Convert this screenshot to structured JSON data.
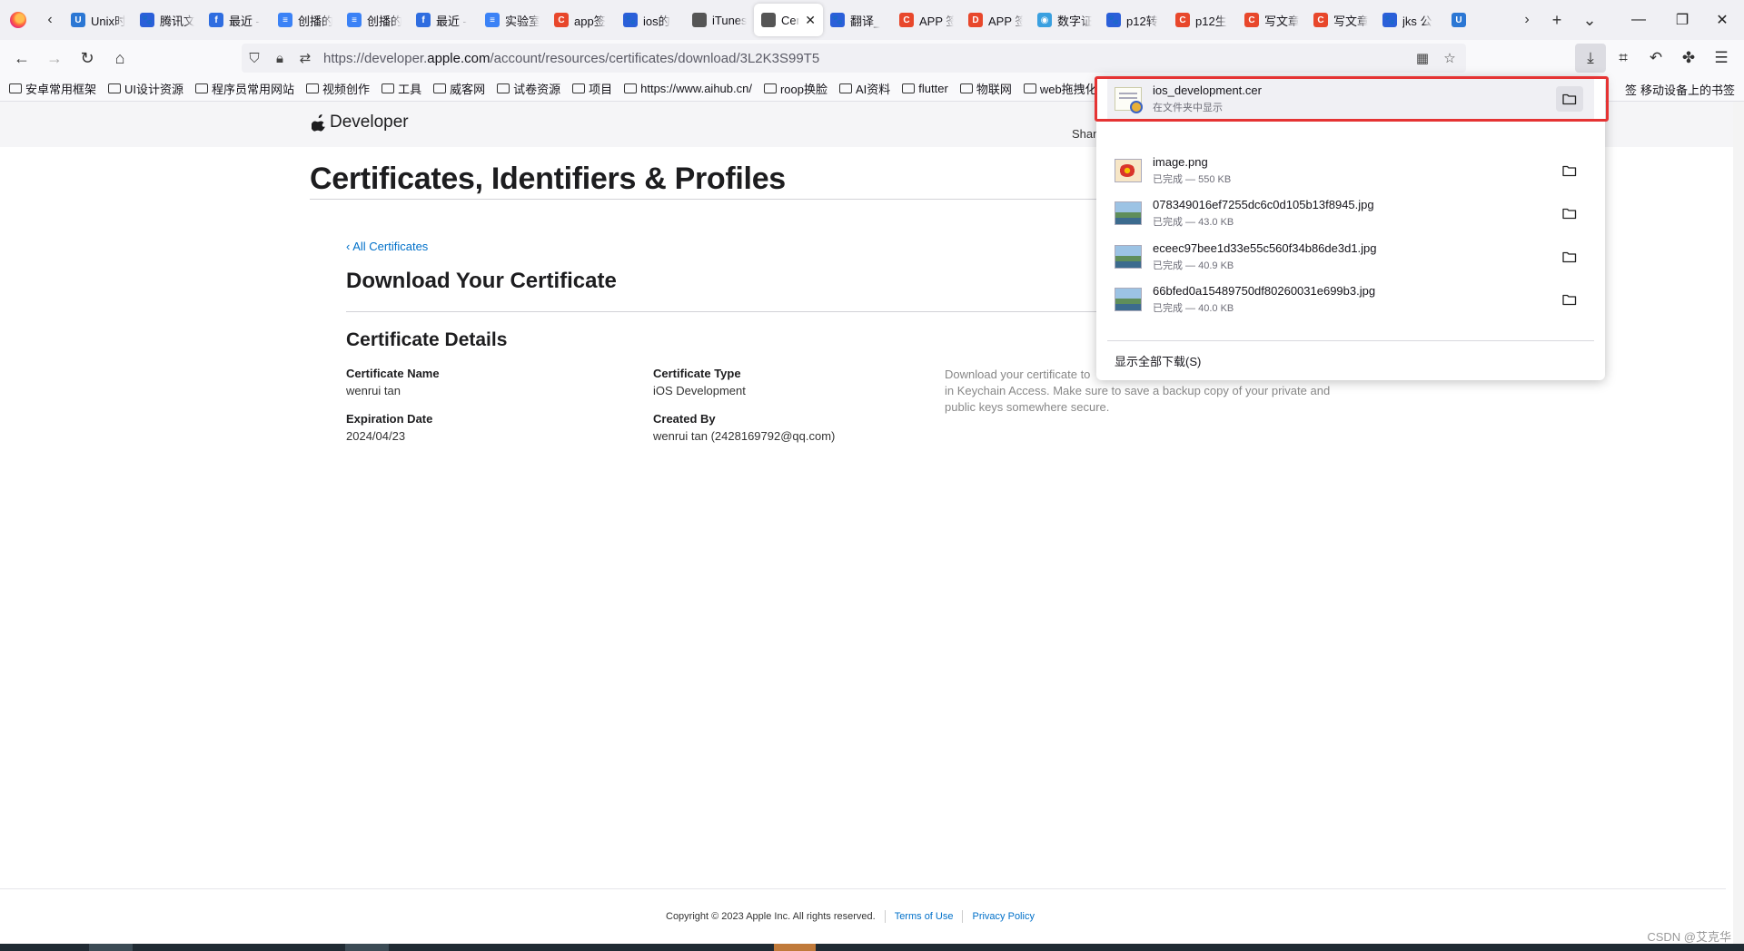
{
  "browser": {
    "tabs": [
      {
        "label": "Unix时",
        "icon_color": "#2b77d4",
        "icon": "U"
      },
      {
        "label": "腾讯文",
        "icon_color": "#2b5fd9",
        "icon": "🐾"
      },
      {
        "label": "最近 -",
        "icon_color": "#2f6de0",
        "icon": "f"
      },
      {
        "label": "创播的",
        "icon_color": "#3b82f6",
        "icon": "≡"
      },
      {
        "label": "创播的",
        "icon_color": "#3b82f6",
        "icon": "≡"
      },
      {
        "label": "最近 -",
        "icon_color": "#2f6de0",
        "icon": "f"
      },
      {
        "label": "实验室",
        "icon_color": "#3b82f6",
        "icon": "≡"
      },
      {
        "label": "app签",
        "icon_color": "#e8472b",
        "icon": "C"
      },
      {
        "label": "ios的",
        "icon_color": "#2b5fd9",
        "icon": "🐾"
      },
      {
        "label": "iTunes",
        "icon_color": "#555555",
        "icon": ""
      },
      {
        "label": "Cer",
        "icon_color": "#555555",
        "icon": "",
        "active": true
      },
      {
        "label": "翻译_",
        "icon_color": "#2b5fd9",
        "icon": "🐾"
      },
      {
        "label": "APP 签",
        "icon_color": "#e8472b",
        "icon": "C"
      },
      {
        "label": "APP 签",
        "icon_color": "#e8472b",
        "icon": "D"
      },
      {
        "label": "数字证",
        "icon_color": "#3aa0e0",
        "icon": "◉"
      },
      {
        "label": "p12转",
        "icon_color": "#2b5fd9",
        "icon": "🐾"
      },
      {
        "label": "p12生",
        "icon_color": "#e8472b",
        "icon": "C"
      },
      {
        "label": "写文章",
        "icon_color": "#e8472b",
        "icon": "C"
      },
      {
        "label": "写文章",
        "icon_color": "#e8472b",
        "icon": "C"
      },
      {
        "label": "jks 公",
        "icon_color": "#2b5fd9",
        "icon": "🐾"
      },
      {
        "label": "",
        "icon_color": "#2b77d4",
        "icon": "U"
      }
    ],
    "url_prefix": "https://developer.",
    "url_domain": "apple.com",
    "url_suffix": "/account/resources/certificates/download/3L2K3S99T5",
    "bookmarks": [
      "安卓常用框架",
      "UI设计资源",
      "程序员常用网站",
      "视频创作",
      "工具",
      "威客网",
      "试卷资源",
      "项目",
      "https://www.aihub.cn/",
      "roop换脸",
      "AI资料",
      "flutter",
      "物联网",
      "web拖拽化布局"
    ],
    "bookmarks_right": [
      "签",
      "移动设备上的书签"
    ]
  },
  "site": {
    "brand": "Developer",
    "user_partial": "Shan",
    "page_title": "Certificates, Identifiers & Profiles",
    "back_link": "‹ All Certificates",
    "download_title": "Download Your Certificate",
    "details_title": "Certificate Details",
    "fields": {
      "name_label": "Certificate Name",
      "name_value": "wenrui tan",
      "type_label": "Certificate Type",
      "type_value": "iOS Development",
      "expiry_label": "Expiration Date",
      "expiry_value": "2024/04/23",
      "created_label": "Created By",
      "created_value": "wenrui tan (2428169792@qq.com)"
    },
    "description_lines": [
      "Download your certificate to",
      "in Keychain Access. Make sure to save a backup copy of your private and",
      "public keys somewhere secure."
    ],
    "footer": {
      "copyright": "Copyright © 2023 Apple Inc. All rights reserved.",
      "terms": "Terms of Use",
      "privacy": "Privacy Policy"
    },
    "watermark": "CSDN @艾克华"
  },
  "downloads": {
    "items": [
      {
        "name": "ios_development.cer",
        "status": "在文件夹中显示",
        "kind": "cert"
      },
      {
        "name": "image.png",
        "status": "已完成 — 550 KB",
        "kind": "png"
      },
      {
        "name": "078349016ef7255dc6c0d105b13f8945.jpg",
        "status": "已完成 — 43.0 KB",
        "kind": "jpg"
      },
      {
        "name": "eceec97bee1d33e55c560f34b86de3d1.jpg",
        "status": "已完成 — 40.9 KB",
        "kind": "jpg"
      },
      {
        "name": "66bfed0a15489750df80260031e699b3.jpg",
        "status": "已完成 — 40.0 KB",
        "kind": "jpg"
      }
    ],
    "show_all": "显示全部下载(S)",
    "highlight_color": "#e53333"
  }
}
